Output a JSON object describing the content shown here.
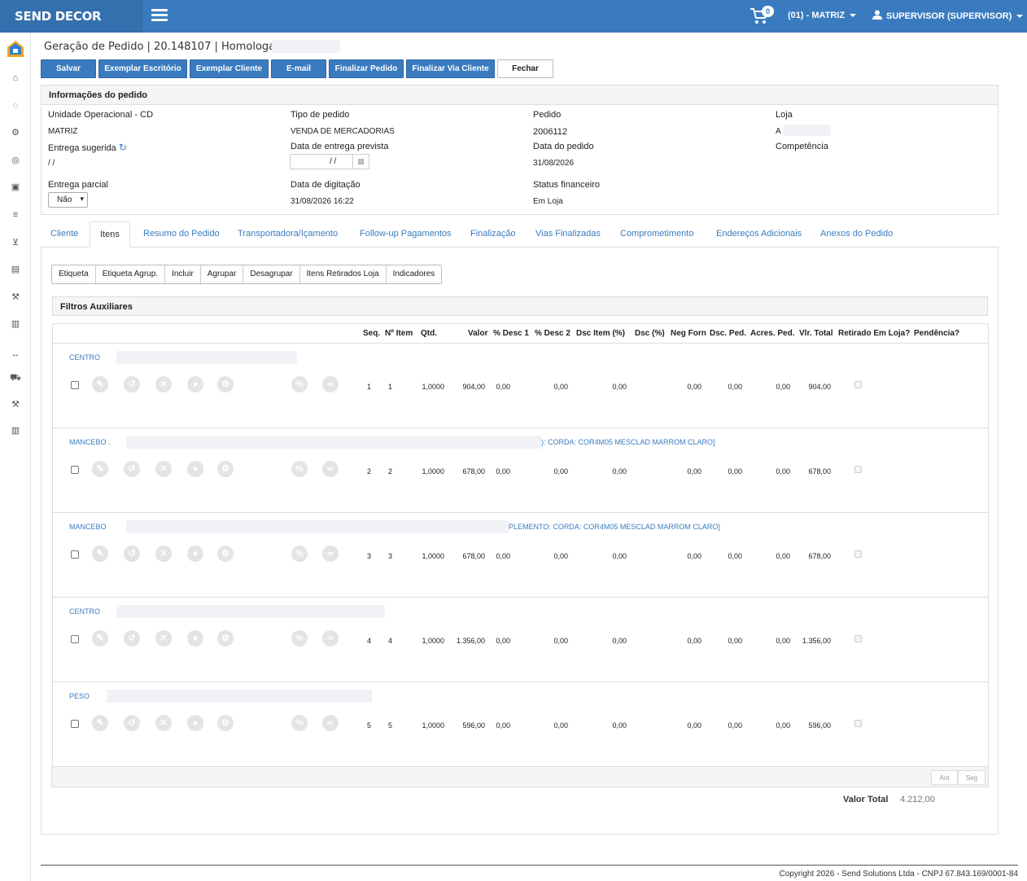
{
  "brand": "SEND DECOR",
  "topbar": {
    "cart_count": "0",
    "unit": "(01) - MATRIZ",
    "user": "SUPERVISOR (SUPERVISOR)"
  },
  "header": {
    "title": "Geração de Pedido | 20.148107 | Homologação |"
  },
  "toolbar": {
    "salvar": "Salvar",
    "exemplar_escritorio": "Exemplar Escritório",
    "exemplar_cliente": "Exemplar Cliente",
    "email": "E-mail",
    "finalizar_pedido": "Finalizar Pedido",
    "finalizar_via_cliente": "Finalizar Via Cliente",
    "fechar": "Fechar"
  },
  "info": {
    "title": "Informações do pedido",
    "unidade_label": "Unidade Operacional - CD",
    "unidade_value": "MATRIZ",
    "tipo_label": "Tipo de pedido",
    "tipo_value": "VENDA DE MERCADORIAS",
    "pedido_label": "Pedido",
    "pedido_value": "2006112",
    "loja_label": "Loja",
    "loja_value": "A",
    "entrega_sugerida_label": "Entrega sugerida",
    "entrega_sugerida_value": "/ /",
    "data_entrega_label": "Data de entrega prevista",
    "data_entrega_value": "/ /",
    "data_pedido_label": "Data do pedido",
    "data_pedido_value": "31/08/2026",
    "competencia_label": "Competência",
    "entrega_parcial_label": "Entrega parcial",
    "entrega_parcial_value": "Não",
    "data_digitacao_label": "Data de digitação",
    "data_digitacao_value": "31/08/2026 16:22",
    "status_label": "Status financeiro",
    "status_value": "Em Loja"
  },
  "tabs": [
    "Cliente",
    "Itens",
    "Resumo do Pedido",
    "Transportadora/Içamento",
    "Follow-up Pagamentos",
    "Finalização",
    "Vias Finalizadas",
    "Comprometimento",
    "Endereços Adicionais",
    "Anexos do Pedido"
  ],
  "subbuttons": [
    "Etiqueta",
    "Etiqueta Agrup.",
    "Incluir",
    "Agrupar",
    "Desagrupar",
    "Itens Retirados Loja",
    "Indicadores"
  ],
  "filtros": "Filtros Auxiliares",
  "columns": [
    "Seq.",
    "Nº Item",
    "Qtd.",
    "Valor",
    "% Desc 1",
    "% Desc 2",
    "Dsc Item (%)",
    "Dsc (%)",
    "Neg Forn",
    "Dsc. Ped.",
    "Acres. Ped.",
    "Vlr. Total",
    "Retirado Em Loja?",
    "Pendência?"
  ],
  "rows": [
    {
      "desc": "CENTRO",
      "desc_tail": "",
      "seq": "1",
      "item": "1",
      "qtd": "1,0000",
      "valor": "904,00",
      "d1": "0,00",
      "d2": "0,00",
      "dscitem": "0,00",
      "neg": "0,00",
      "dscped": "0,00",
      "acres": "0,00",
      "total": "904,00"
    },
    {
      "desc": "MANCEBO .",
      "desc_tail": "): CORDA: COR4M05 MESCLAD MARROM CLARO]",
      "seq": "2",
      "item": "2",
      "qtd": "1,0000",
      "valor": "678,00",
      "d1": "0,00",
      "d2": "0,00",
      "dscitem": "0,00",
      "neg": "0,00",
      "dscped": "0,00",
      "acres": "0,00",
      "total": "678,00"
    },
    {
      "desc": "MANCEBO",
      "desc_tail": "PLEMENTO: CORDA: COR4M05 MESCLAD MARROM CLARO]",
      "seq": "3",
      "item": "3",
      "qtd": "1,0000",
      "valor": "678,00",
      "d1": "0,00",
      "d2": "0,00",
      "dscitem": "0,00",
      "neg": "0,00",
      "dscped": "0,00",
      "acres": "0,00",
      "total": "678,00"
    },
    {
      "desc": "CENTRO",
      "desc_tail": "",
      "seq": "4",
      "item": "4",
      "qtd": "1,0000",
      "valor": "1.356,00",
      "d1": "0,00",
      "d2": "0,00",
      "dscitem": "0,00",
      "neg": "0,00",
      "dscped": "0,00",
      "acres": "0,00",
      "total": "1.356,00"
    },
    {
      "desc": "PESO",
      "desc_tail": "",
      "seq": "5",
      "item": "5",
      "qtd": "1,0000",
      "valor": "596,00",
      "d1": "0,00",
      "d2": "0,00",
      "dscitem": "0,00",
      "neg": "0,00",
      "dscped": "0,00",
      "acres": "0,00",
      "total": "596,00"
    }
  ],
  "pager": {
    "prev": "Ant",
    "next": "Seg"
  },
  "valor_total_label": "Valor Total",
  "valor_total": "4.212,00",
  "copyright": "Copyright 2026 - Send Solutions Ltda - CNPJ 67.843.169/0001-84"
}
